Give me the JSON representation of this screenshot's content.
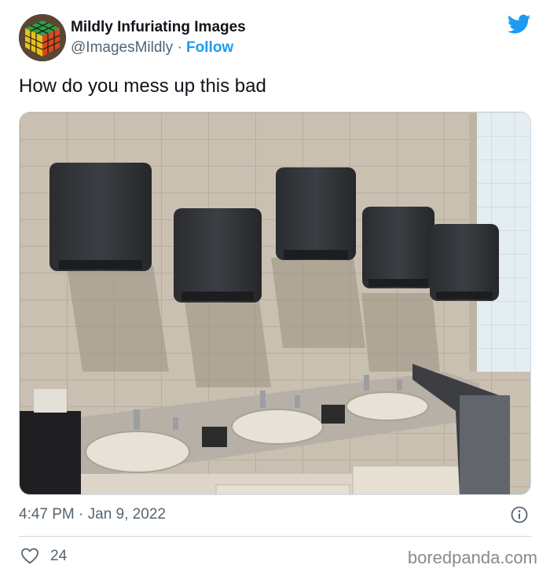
{
  "account": {
    "display_name": "Mildly Infuriating Images",
    "handle": "@ImagesMildly",
    "separator": "·",
    "follow_label": "Follow"
  },
  "tweet": {
    "text": "How do you mess up this bad",
    "timestamp": "4:47 PM · Jan 9, 2022",
    "like_count": "24",
    "photo_description_icon": "image"
  },
  "icons": {
    "brand": "twitter-bird-icon",
    "info": "info-icon",
    "like": "heart-icon"
  },
  "colors": {
    "accent": "#1d9bf0",
    "text_primary": "#0f1419",
    "text_secondary": "#536471"
  },
  "watermark": "boredpanda.com"
}
